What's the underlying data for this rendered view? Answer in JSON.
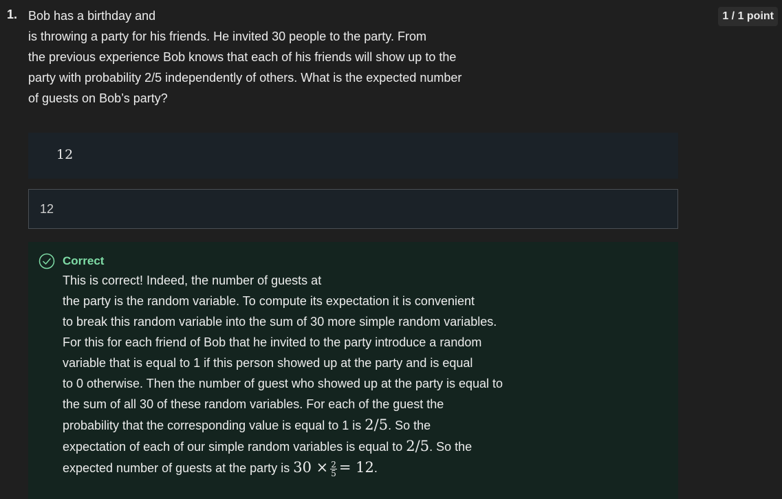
{
  "question": {
    "number": "1.",
    "points": "1 / 1 point",
    "prompt_lines": [
      "Bob has a birthday and",
      "is throwing a party for his friends. He invited 30 people to the party. From",
      "the previous experience Bob knows that each of his friends will show up to the",
      "party with probability 2/5 independently of others. What is the expected number",
      "of guests on Bob’s party?"
    ]
  },
  "answer": {
    "rendered_value": "12",
    "input_value": "12"
  },
  "feedback": {
    "status": "Correct",
    "status_color": "#7fdca6",
    "icon": "check-circle-icon",
    "lines": [
      "This is correct! Indeed, the number of guests at",
      "the party is the random variable. To compute its expectation it is convenient",
      "to break this random variable into the sum of 30 more simple random variables.",
      "For this for each friend of Bob that he invited to the party introduce a random",
      "variable that is equal to 1 if this person showed up at the party and is equal",
      "to 0 otherwise. Then the number of guest who showed up at the party is equal to",
      "the sum of all 30 of these random variables. For each of the guest the"
    ],
    "line8": {
      "text": "probability that the corresponding value is equal to 1 is ",
      "math": "2/5",
      "tail": ". So the"
    },
    "line9": {
      "text": "expectation of each of our simple random variables is equal to ",
      "math": "2/5",
      "tail": ". So the"
    },
    "line10": {
      "text": "expected number of guests at the party is ",
      "math_a": "30 ×",
      "frac_num": "2",
      "frac_den": "5",
      "math_b": "= 12",
      "tail": "."
    }
  }
}
